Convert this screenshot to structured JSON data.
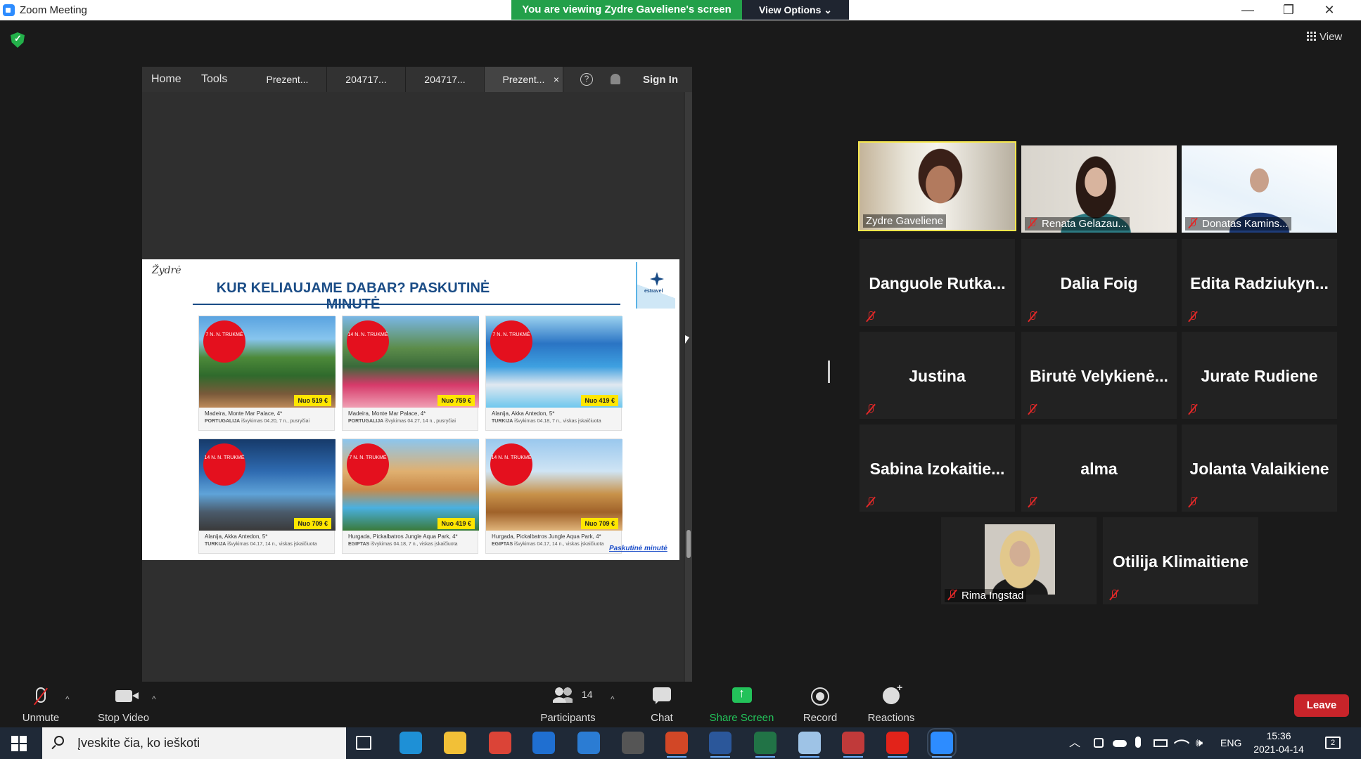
{
  "window": {
    "title": "Zoom Meeting",
    "viewing_banner": "You are viewing Zydre Gaveliene's screen",
    "view_options": "View Options ⌄",
    "minimize": "—",
    "restore": "❐",
    "close": "✕",
    "view_button": "View"
  },
  "shared_screen": {
    "toolbar": {
      "home": "Home",
      "tools": "Tools",
      "tabs": [
        "Prezent...",
        "204717...",
        "204717...",
        "Prezent..."
      ],
      "tab_close": "×",
      "help": "?",
      "sign_in": "Sign In"
    },
    "slide": {
      "author": "Žydrė",
      "heading": "KUR KELIAUJAME DABAR? PASKUTINĖ MINUTĖ",
      "logo_text": "estravel",
      "badge_prefix": "N. TRUKMĖ",
      "cards": [
        {
          "nights": "7 N.",
          "price": "Nuo 519 €",
          "name": "Madeira, Monte Mar Palace, 4*",
          "country": "PORTUGALIJA",
          "detail": "išvykimas 04.20, 7 n., pusryčiai"
        },
        {
          "nights": "14 N.",
          "price": "Nuo 759 €",
          "name": "Madeira, Monte Mar Palace, 4*",
          "country": "PORTUGALIJA",
          "detail": "išvykimas 04.27, 14 n., pusryčiai"
        },
        {
          "nights": "7 N.",
          "price": "Nuo 419 €",
          "name": "Alanija, Akka Antedon, 5*",
          "country": "TURKIJA",
          "detail": "išvykimas 04.18, 7 n., viskas įskaičiuota"
        },
        {
          "nights": "14 N.",
          "price": "Nuo 709 €",
          "name": "Alanija, Akka Antedon, 5*",
          "country": "TURKIJA",
          "detail": "išvykimas 04.17, 14 n., viskas įskaičiuota"
        },
        {
          "nights": "7 N.",
          "price": "Nuo 419 €",
          "name": "Hurgada, Pickalbatros Jungle Aqua Park, 4*",
          "country": "EGIPTAS",
          "detail": "išvykimas 04.18, 7 n., viskas įskaičiuota"
        },
        {
          "nights": "14 N.",
          "price": "Nuo 709 €",
          "name": "Hurgada, Pickalbatros Jungle Aqua Park, 4*",
          "country": "EGIPTAS",
          "detail": "išvykimas 04.17, 14 n., viskas įskaičiuota"
        }
      ],
      "footer_link": "Paskutinė minutė"
    }
  },
  "participants": [
    {
      "name": "Zydre Gaveliene",
      "video": true,
      "active": true,
      "muted": false
    },
    {
      "name": "Renata Gelazau...",
      "video": true,
      "active": false,
      "muted": true
    },
    {
      "name": "Donatas Kamins...",
      "video": true,
      "active": false,
      "muted": true
    },
    {
      "name": "Danguole  Rutka...",
      "video": false,
      "muted": true
    },
    {
      "name": "Dalia Foig",
      "video": false,
      "muted": true
    },
    {
      "name": "Edita  Radziukyn...",
      "video": false,
      "muted": true
    },
    {
      "name": "Justina",
      "video": false,
      "muted": true
    },
    {
      "name": "Birutė  Velykienė...",
      "video": false,
      "muted": true
    },
    {
      "name": "Jurate Rudiene",
      "video": false,
      "muted": true
    },
    {
      "name": "Sabina  Izokaitie...",
      "video": false,
      "muted": true
    },
    {
      "name": "alma",
      "video": false,
      "muted": true
    },
    {
      "name": "Jolanta Valaikiene",
      "video": false,
      "muted": true
    },
    {
      "name": "Rima Ingstad",
      "video": true,
      "muted": true
    },
    {
      "name": "Otilija Klimaitiene",
      "video": false,
      "muted": true
    }
  ],
  "toolbar": {
    "unmute": "Unmute",
    "stop_video": "Stop Video",
    "participants": "Participants",
    "participant_count": "14",
    "chat": "Chat",
    "share_screen": "Share Screen",
    "record": "Record",
    "reactions": "Reactions",
    "leave": "Leave",
    "caret": "^"
  },
  "taskbar": {
    "search_placeholder": "Įveskite čia, ko ieškoti",
    "language": "ENG",
    "time": "15:36",
    "date": "2021-04-14",
    "notifications_count": "2",
    "apps": [
      "task-view",
      "edge",
      "file-explorer",
      "chrome",
      "store",
      "mail",
      "app-slash",
      "powerpoint",
      "word",
      "excel",
      "paint",
      "app-red",
      "acrobat",
      "zoom"
    ]
  },
  "colors": {
    "banner_green": "#23a04a",
    "active_speaker": "#f6e84d",
    "leave_red": "#c8242a",
    "share_green": "#23c25a",
    "slide_blue": "#1a4c86"
  }
}
